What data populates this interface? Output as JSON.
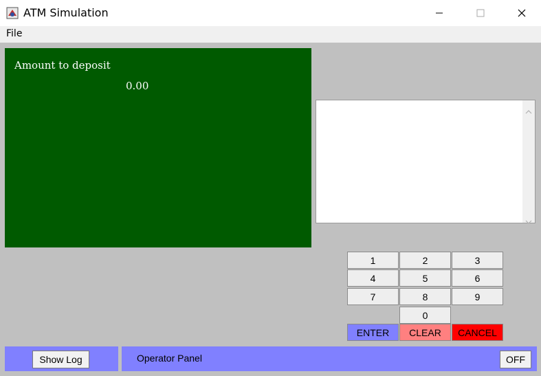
{
  "window": {
    "title": "ATM Simulation",
    "controls": {
      "minimize_icon": "minimize-icon",
      "maximize_icon": "maximize-icon",
      "close_icon": "close-icon"
    }
  },
  "menu": {
    "file_label": "File"
  },
  "screen": {
    "background": "#005a00",
    "line1": "Amount to deposit",
    "line2": "0.00"
  },
  "receipt": {
    "text": ""
  },
  "keypad": {
    "keys": [
      "1",
      "2",
      "3",
      "4",
      "5",
      "6",
      "7",
      "8",
      "9",
      "0"
    ],
    "enter": {
      "label": "ENTER",
      "color": "#8080ff"
    },
    "clear": {
      "label": "CLEAR",
      "color": "#ff8080"
    },
    "cancel": {
      "label": "CANCEL",
      "color": "#ff0000"
    }
  },
  "log_panel": {
    "show_log_label": "Show Log",
    "color": "#8080ff"
  },
  "operator_panel": {
    "label": "Operator Panel",
    "switch_label": "OFF",
    "color": "#8080ff"
  }
}
